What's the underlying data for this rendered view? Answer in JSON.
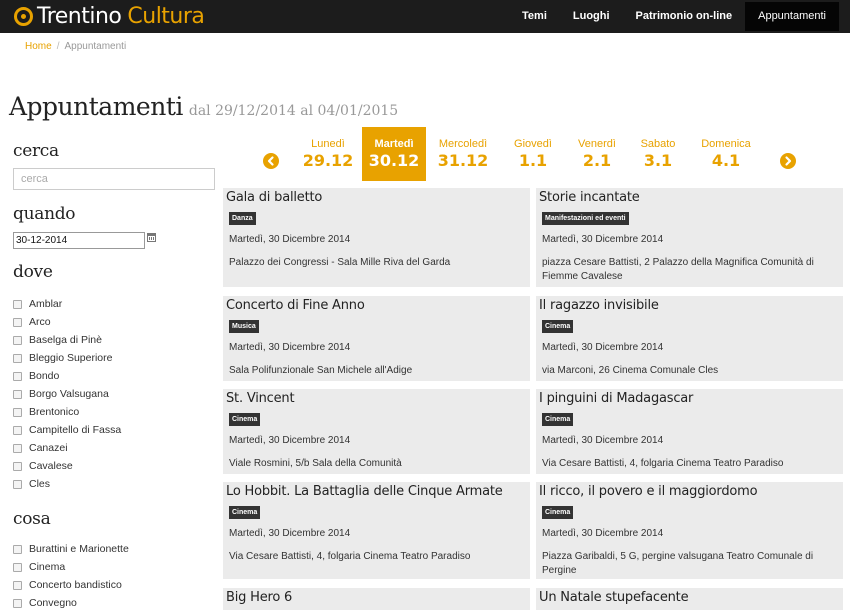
{
  "brand": {
    "name_part1": "Trentino",
    "name_part2": "Cultura",
    "accent": "#e8a200"
  },
  "nav": {
    "items": [
      "Temi",
      "Luoghi",
      "Patrimonio on-line",
      "Appuntamenti"
    ],
    "active": "Appuntamenti"
  },
  "breadcrumb": {
    "home": "Home",
    "separator": "/",
    "current": "Appuntamenti"
  },
  "page": {
    "title": "Appuntamenti",
    "range": "dal 29/12/2014 al 04/01/2015"
  },
  "sidebar": {
    "search": {
      "heading": "cerca",
      "placeholder": "cerca",
      "value": ""
    },
    "when": {
      "heading": "quando",
      "date": "30-12-2014"
    },
    "where": {
      "heading": "dove",
      "options": [
        "Amblar",
        "Arco",
        "Baselga di Pinè",
        "Bleggio Superiore",
        "Bondo",
        "Borgo Valsugana",
        "Brentonico",
        "Campitello di Fassa",
        "Canazei",
        "Cavalese",
        "Cles"
      ]
    },
    "what": {
      "heading": "cosa",
      "options": [
        "Burattini e Marionette",
        "Cinema",
        "Concerto bandistico",
        "Convegno"
      ]
    }
  },
  "week": {
    "days": [
      {
        "name": "Lunedì",
        "date": "29.12",
        "active": false
      },
      {
        "name": "Martedì",
        "date": "30.12",
        "active": true
      },
      {
        "name": "Mercoledì",
        "date": "31.12",
        "active": false
      },
      {
        "name": "Giovedì",
        "date": "1.1",
        "active": false
      },
      {
        "name": "Venerdì",
        "date": "2.1",
        "active": false
      },
      {
        "name": "Sabato",
        "date": "3.1",
        "active": false
      },
      {
        "name": "Domenica",
        "date": "4.1",
        "active": false
      }
    ]
  },
  "events": [
    {
      "title": "Gala di balletto",
      "category": "Danza",
      "date": "Martedì, 30 Dicembre 2014",
      "place": "Palazzo dei Congressi - Sala Mille Riva del Garda"
    },
    {
      "title": "Storie incantate",
      "category": "Manifestazioni ed eventi",
      "date": "Martedì, 30 Dicembre 2014",
      "place": "piazza Cesare Battisti, 2 Palazzo della Magnifica Comunità di Fiemme Cavalese"
    },
    {
      "title": "Concerto di Fine Anno",
      "category": "Musica",
      "date": "Martedì, 30 Dicembre 2014",
      "place": "Sala Polifunzionale San Michele all'Adige"
    },
    {
      "title": "Il ragazzo invisibile",
      "category": "Cinema",
      "date": "Martedì, 30 Dicembre 2014",
      "place": "via Marconi, 26 Cinema Comunale Cles"
    },
    {
      "title": "St. Vincent",
      "category": "Cinema",
      "date": "Martedì, 30 Dicembre 2014",
      "place": "Viale Rosmini, 5/b Sala della Comunità"
    },
    {
      "title": "I pinguini di Madagascar",
      "category": "Cinema",
      "date": "Martedì, 30 Dicembre 2014",
      "place": "Via Cesare Battisti, 4, folgaria Cinema Teatro Paradiso"
    },
    {
      "title": "Lo Hobbit. La Battaglia delle Cinque Armate",
      "category": "Cinema",
      "date": "Martedì, 30 Dicembre 2014",
      "place": "Via Cesare Battisti, 4, folgaria Cinema Teatro Paradiso"
    },
    {
      "title": "Il ricco, il povero e il maggiordomo",
      "category": "Cinema",
      "date": "Martedì, 30 Dicembre 2014",
      "place": "Piazza Garibaldi, 5 G, pergine valsugana Teatro Comunale di Pergine"
    },
    {
      "title": "Big Hero 6",
      "category": "",
      "date": "",
      "place": ""
    },
    {
      "title": "Un Natale stupefacente",
      "category": "",
      "date": "",
      "place": ""
    }
  ],
  "icons": {
    "prev": "chevron-left-circle-icon",
    "next": "chevron-right-circle-icon",
    "calendar": "calendar-icon",
    "logo": "logo-ring-icon"
  }
}
